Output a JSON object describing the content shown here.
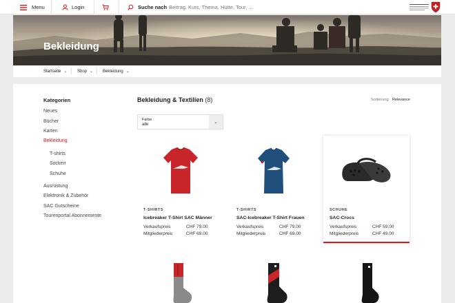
{
  "topbar": {
    "menu_label": "Menu",
    "login_label": "Login",
    "search_bold": "Suche nach",
    "search_placeholder": "Beitrag, Kurs, Thema, Hütte, Tour, ..."
  },
  "hero": {
    "title": "Bekleidung"
  },
  "breadcrumb": [
    "Startseite",
    "Shop",
    "Bekleidung"
  ],
  "sidebar": {
    "title": "Kategorien",
    "items": [
      {
        "label": "Neues",
        "active": false,
        "level": 0
      },
      {
        "label": "Bücher",
        "active": false,
        "level": 0
      },
      {
        "label": "Karten",
        "active": false,
        "level": 0
      },
      {
        "label": "Bekleidung",
        "active": true,
        "level": 0
      },
      {
        "label": "T-shirts",
        "active": false,
        "level": 1
      },
      {
        "label": "Socken",
        "active": false,
        "level": 1
      },
      {
        "label": "Schuhe",
        "active": false,
        "level": 1
      },
      {
        "label": "Ausrüstung",
        "active": false,
        "level": 0
      },
      {
        "label": "Elektronik & Zubehör",
        "active": false,
        "level": 0
      },
      {
        "label": "SAC Gutscheine",
        "active": false,
        "level": 0
      },
      {
        "label": "Tourenportal Abonnemente",
        "active": false,
        "level": 0
      }
    ]
  },
  "listing": {
    "title": "Bekleidung & Textilien",
    "count": "(8)",
    "sort_label": "Sortierung:",
    "sort_value": "Relevance",
    "filter_label": "Farbe",
    "filter_value": "alle"
  },
  "products": [
    {
      "category": "T-SHIRTS",
      "name": "Icebreaker T-Shirt SAC Männer",
      "price_label": "Verkaufspreis",
      "price": "CHF 79.00",
      "member_label": "Mitgliederpreis",
      "member_price": "CHF 69.00",
      "image": "red-tshirt",
      "highlighted": false
    },
    {
      "category": "T-SHIRTS",
      "name": "SAC-Icebreaker T-Shirt Frauen",
      "price_label": "Verkaufspreis",
      "price": "CHF 79.00",
      "member_label": "Mitgliederpreis",
      "member_price": "CHF 69.00",
      "image": "blue-tshirt",
      "highlighted": false
    },
    {
      "category": "SCHUHE",
      "name": "SAC-Crocs",
      "price_label": "Verkaufspreis",
      "price": "CHF 59.00",
      "member_label": "Mitgliederpreis",
      "member_price": "CHF 49.00",
      "image": "black-crocs",
      "highlighted": true
    }
  ],
  "colors": {
    "accent": "#d4171e",
    "panel_bg": "#ffffff",
    "page_bg": "#ececec"
  },
  "icons": [
    "hamburger-icon",
    "user-icon",
    "cart-icon",
    "search-icon",
    "sac-logo",
    "chevron-down-icon"
  ]
}
